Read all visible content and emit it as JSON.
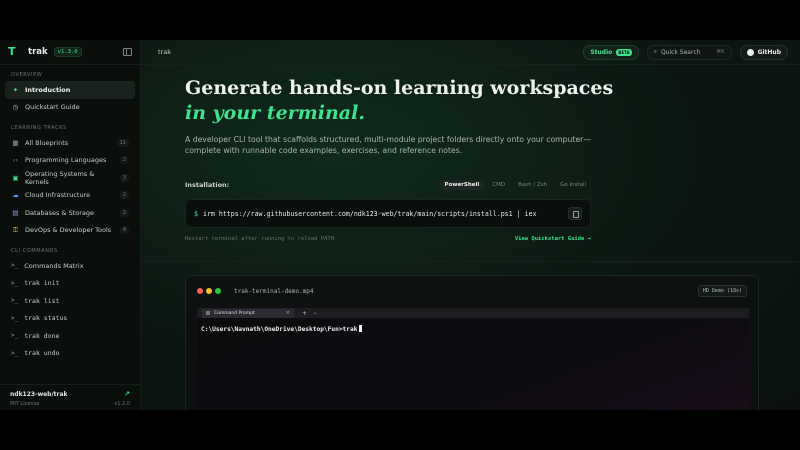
{
  "brand": {
    "name": "trak",
    "version": "v1.3.0"
  },
  "sidebar": {
    "sections": [
      {
        "title": "OVERVIEW",
        "items": [
          {
            "label": "Introduction",
            "icon": "sparkle-icon",
            "glyph": "✦",
            "color": "#3ee28a",
            "active": true
          },
          {
            "label": "Quickstart Guide",
            "icon": "timer-icon",
            "glyph": "◷",
            "color": "#c6cec9"
          }
        ]
      },
      {
        "title": "LEARNING TRACKS",
        "items": [
          {
            "label": "All Blueprints",
            "icon": "grid-icon",
            "glyph": "▦",
            "color": "#9aa49e",
            "count": "11"
          },
          {
            "label": "Programming Languages",
            "icon": "code-icon",
            "glyph": "‹›",
            "color": "#5a9cff",
            "count": "2"
          },
          {
            "label": "Operating Systems & Kernels",
            "icon": "chip-icon",
            "glyph": "▣",
            "color": "#3ee28a",
            "count": "3"
          },
          {
            "label": "Cloud Infrastructure",
            "icon": "cloud-icon",
            "glyph": "☁",
            "color": "#5a9cff",
            "count": "2"
          },
          {
            "label": "Databases & Storage",
            "icon": "database-icon",
            "glyph": "▤",
            "color": "#b48cff",
            "count": "2"
          },
          {
            "label": "DevOps & Developer Tools",
            "icon": "key-icon",
            "glyph": "⚿",
            "color": "#f0b43c",
            "count": "4"
          }
        ]
      },
      {
        "title": "CLI COMMANDS",
        "items": [
          {
            "label": "Commands Matrix",
            "mono": false
          },
          {
            "label": "trak init",
            "mono": true
          },
          {
            "label": "trak list",
            "mono": true
          },
          {
            "label": "trak status",
            "mono": true
          },
          {
            "label": "trak done",
            "mono": true
          },
          {
            "label": "trak undo",
            "mono": true
          }
        ]
      }
    ],
    "footer": {
      "repo": "ndk123-web/trak",
      "license": "MIT License",
      "version": "v1.2.0"
    }
  },
  "topbar": {
    "breadcrumb": "trak",
    "studio": {
      "label": "Studio",
      "badge": "BETA"
    },
    "search": {
      "label": "Quick Search",
      "shortcut": "⌘K"
    },
    "github": {
      "label": "GitHub"
    }
  },
  "hero": {
    "title_main": "Generate hands-on learning workspaces ",
    "title_accent": "in your terminal.",
    "description": "A developer CLI tool that scaffolds structured, multi-module project folders directly onto your computer—complete with runnable code examples, exercises, and reference notes."
  },
  "install": {
    "label": "Installation:",
    "tabs": [
      {
        "label": "PowerShell",
        "active": true
      },
      {
        "label": "CMD"
      },
      {
        "label": "Bash / Zsh"
      },
      {
        "label": "Go Install"
      }
    ],
    "prompt": "$",
    "command": "irm https://raw.githubusercontent.com/ndk123-web/trak/main/scripts/install.ps1 | iex",
    "hint": "Restart terminal after running to reload PATH",
    "quickstart_link": "View Quickstart Guide →"
  },
  "video": {
    "title": "trak-terminal-demo.mp4",
    "badge": "HD Demo (18s)",
    "dots": [
      "#ff5f57",
      "#febc2e",
      "#28c840"
    ],
    "terminal": {
      "tab_label": "Command Prompt",
      "tab_close": "×",
      "plus": "+",
      "chevron": "⌄",
      "line": "C:\\Users\\Navnath\\OneDrive\\Desktop\\Fun>trak"
    }
  }
}
